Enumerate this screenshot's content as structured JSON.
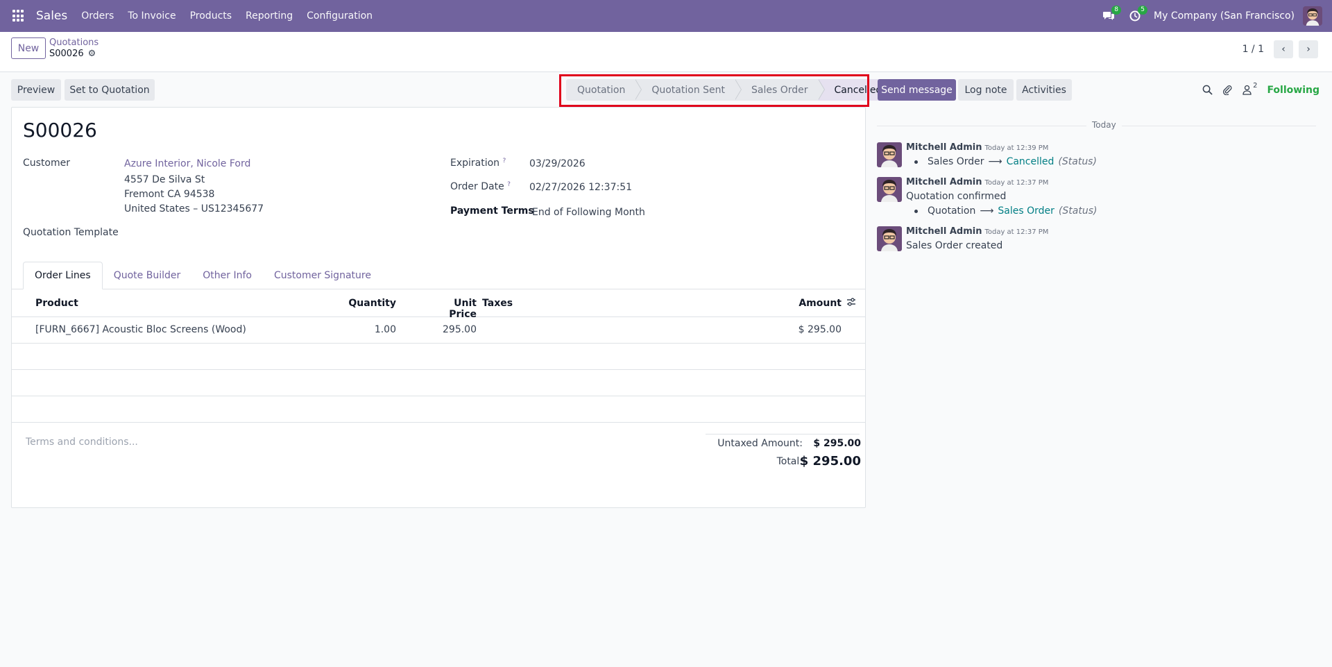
{
  "navbar": {
    "brand": "Sales",
    "menu": [
      "Orders",
      "To Invoice",
      "Products",
      "Reporting",
      "Configuration"
    ],
    "messages_count": "8",
    "activities_count": "5",
    "company": "My Company (San Francisco)"
  },
  "control_panel": {
    "new_label": "New",
    "breadcrumb_parent": "Quotations",
    "breadcrumb_current": "S00026",
    "pager": "1 / 1"
  },
  "actions": {
    "preview": "Preview",
    "set_to_quotation": "Set to Quotation"
  },
  "statusbar": {
    "stages": [
      "Quotation",
      "Quotation Sent",
      "Sales Order",
      "Cancelled"
    ],
    "active": "Cancelled"
  },
  "form": {
    "title": "S00026",
    "customer_label": "Customer",
    "customer_name": "Azure Interior, Nicole Ford",
    "address_line1": "4557 De Silva St",
    "address_line2": "Fremont CA 94538",
    "address_line3": "United States – US12345677",
    "template_label": "Quotation Template",
    "expiration_label": "Expiration",
    "expiration_value": "03/29/2026",
    "order_date_label": "Order Date",
    "order_date_value": "02/27/2026 12:37:51",
    "payment_terms_label": "Payment Terms",
    "payment_terms_value": "End of Following Month",
    "help_mark": "?"
  },
  "tabs": [
    "Order Lines",
    "Quote Builder",
    "Other Info",
    "Customer Signature"
  ],
  "order_lines": {
    "headers": {
      "product": "Product",
      "quantity": "Quantity",
      "unit_price": "Unit Price",
      "taxes": "Taxes",
      "amount": "Amount"
    },
    "rows": [
      {
        "product": "[FURN_6667] Acoustic Bloc Screens (Wood)",
        "quantity": "1.00",
        "unit_price": "295.00",
        "taxes": "",
        "amount": "$ 295.00"
      }
    ]
  },
  "terms_placeholder": "Terms and conditions...",
  "totals": {
    "untaxed_label": "Untaxed Amount:",
    "untaxed_value": "$ 295.00",
    "total_label": "Total:",
    "total_value": "$ 295.00"
  },
  "chatter": {
    "send_message": "Send message",
    "log_note": "Log note",
    "activities": "Activities",
    "followers_count": "2",
    "following": "Following",
    "today": "Today",
    "messages": [
      {
        "author": "Mitchell Admin",
        "date": "Today at 12:39 PM",
        "body": "",
        "tracking": {
          "old": "Sales Order",
          "new": "Cancelled",
          "field": "(Status)"
        }
      },
      {
        "author": "Mitchell Admin",
        "date": "Today at 12:37 PM",
        "body": "Quotation confirmed",
        "tracking": {
          "old": "Quotation",
          "new": "Sales Order",
          "field": "(Status)"
        }
      },
      {
        "author": "Mitchell Admin",
        "date": "Today at 12:37 PM",
        "body": "Sales Order created"
      }
    ]
  },
  "colors": {
    "brand": "#71639e",
    "following": "#28a745",
    "tracking_value": "#017e84",
    "highlight": "#e0001b"
  }
}
